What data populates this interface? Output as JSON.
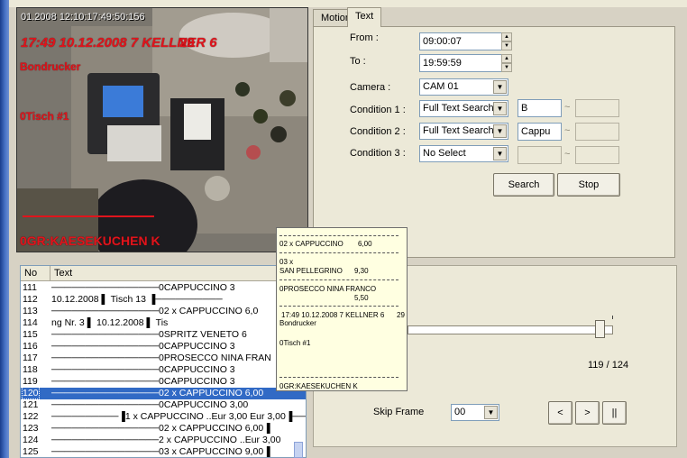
{
  "video": {
    "timestamp": "01.2008 12:10:17:49:50:156",
    "overlay_line1": "17:49 10.12.2008 7 KELLNER 6",
    "overlay_line1_num": "29",
    "overlay_bondrucker": "Bondrucker",
    "overlay_tisch": "0Tisch #1",
    "overlay_item": "0GR:KAESEKUCHEN K"
  },
  "tabs": [
    "Motion",
    "Text"
  ],
  "search": {
    "from_label": "From :",
    "from_value": "09:00:07",
    "to_label": "To :",
    "to_value": "19:59:59",
    "camera_label": "Camera :",
    "camera_value": "CAM 01",
    "condition1_label": "Condition 1 :",
    "condition1_mode": "Full Text Search",
    "condition1_value": "B",
    "condition2_label": "Condition 2 :",
    "condition2_mode": "Full Text Search",
    "condition2_value": "Cappu",
    "condition3_label": "Condition 3 :",
    "condition3_mode": "No Select",
    "condition3_value": "",
    "range_dash": "~",
    "search_button": "Search",
    "stop_button": "Stop"
  },
  "playback": {
    "frame_counter": "119 / 124",
    "slider_fraction": 0.96,
    "skip_label": "Skip Frame",
    "skip_value": "00",
    "prev_button": "<",
    "next_button": ">",
    "pause_button": "||"
  },
  "list": {
    "col_no": "No",
    "col_text": "Text",
    "rows": [
      {
        "no": "111",
        "text": "────────────────0CAPPUCCINO          3"
      },
      {
        "no": "112",
        "text": "10.12.2008      ▌           Tisch 13          ▐──────────"
      },
      {
        "no": "113",
        "text": "────────────────02 x CAPPUCCINO       6,0"
      },
      {
        "no": "114",
        "text": "ng Nr. 3         ▌        10.12.2008      ▌           Tis"
      },
      {
        "no": "115",
        "text": "────────────────0SPRITZ VENETO        6"
      },
      {
        "no": "116",
        "text": "────────────────0CAPPUCCINO          3"
      },
      {
        "no": "117",
        "text": "────────────────0PROSECCO NINA FRAN"
      },
      {
        "no": "118",
        "text": "────────────────0CAPPUCCINO          3"
      },
      {
        "no": "119",
        "text": "────────────────0CAPPUCCINO          3"
      },
      {
        "no": "120",
        "text": "────────────────02 x CAPPUCCINO       6,00"
      },
      {
        "no": "121",
        "text": "────────────────0CAPPUCCINO          3,00"
      },
      {
        "no": "122",
        "text": "──────────▐1 x CAPPUCCINO   ..Eur 3,00     Eur 3,00▐────"
      },
      {
        "no": "123",
        "text": "────────────────02 x CAPPUCCINO       6,00▐"
      },
      {
        "no": "124",
        "text": "────────────────2 x CAPPUCCINO   ..Eur 3,00"
      },
      {
        "no": "125",
        "text": "────────────────03 x CAPPUCCINO       9,00▐"
      }
    ],
    "selected_index": 9
  },
  "popup": {
    "line1": "02 x CAPPUCCINO",
    "line1_price": "6,00",
    "line2": "03 x",
    "line3": "SAN PELLEGRINO",
    "line3_price": "9,30",
    "line4": "0PROSECCO NINA FRANCO",
    "line4_price": "5,50",
    "line5": "17:49 10.12.2008 7 KELLNER 6",
    "line5_num": "29",
    "line6": "Bondrucker",
    "line7": "0Tisch #1",
    "line8": "0GR:KAESEKUCHEN K"
  }
}
